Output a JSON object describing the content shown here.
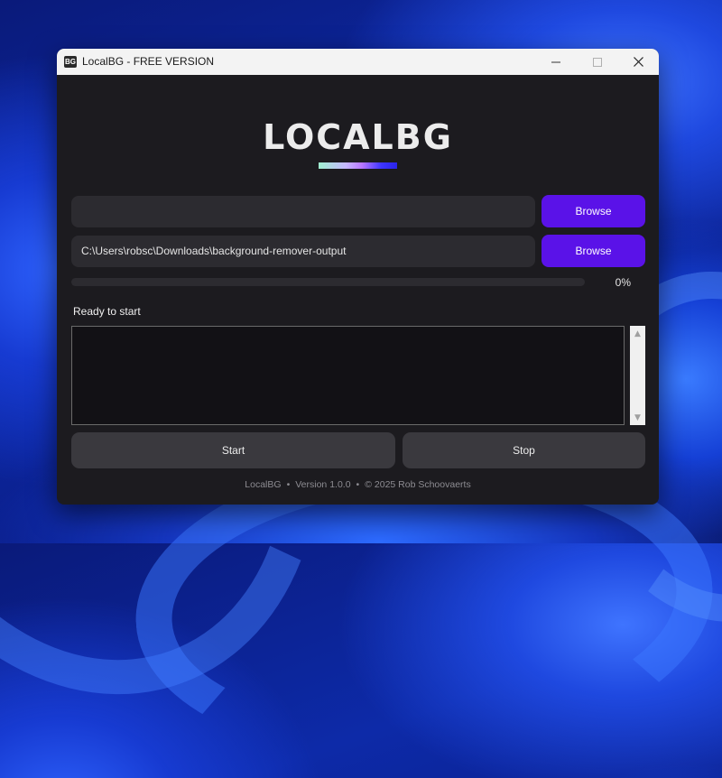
{
  "window": {
    "icon_text": "BG",
    "title": "LocalBG - FREE VERSION"
  },
  "logo": {
    "text": "LOCALBG"
  },
  "input_path": {
    "value": ""
  },
  "output_path": {
    "value": "C:\\Users\\robsc\\Downloads\\background-remover-output"
  },
  "browse_input_label": "Browse",
  "browse_output_label": "Browse",
  "progress": {
    "value": 0,
    "label": "0%"
  },
  "status": {
    "text": "Ready to start"
  },
  "log": {
    "value": ""
  },
  "actions": {
    "start_label": "Start",
    "stop_label": "Stop"
  },
  "footer": {
    "app": "LocalBG",
    "version": "Version 1.0.0",
    "copyright": "© 2025 Rob Schoovaerts",
    "separator": "•"
  },
  "colors": {
    "accent": "#5a12e8",
    "window_bg": "#1c1b1f",
    "field_bg": "#2c2b30",
    "button_bg": "#3a393e"
  },
  "icons": [
    "app-logo-icon",
    "minimize-icon",
    "maximize-icon",
    "close-icon",
    "scroll-up-arrow-icon",
    "scroll-down-arrow-icon"
  ]
}
